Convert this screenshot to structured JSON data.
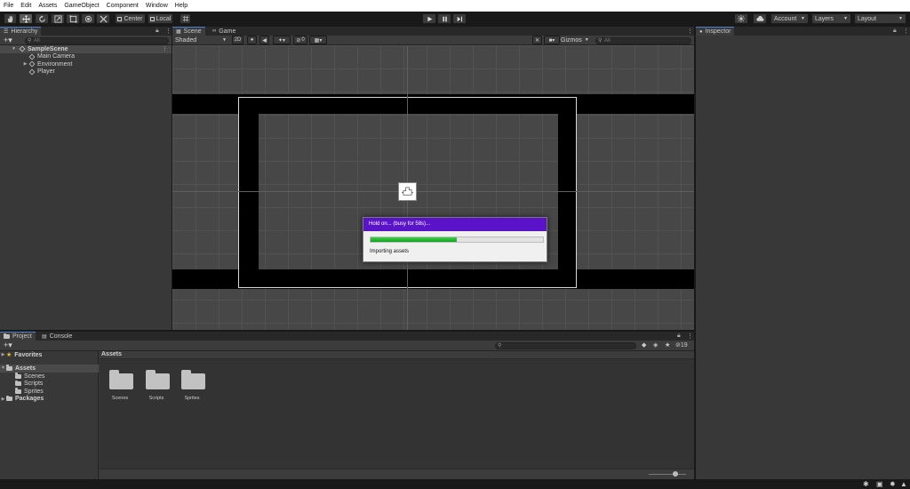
{
  "menu": [
    "File",
    "Edit",
    "Assets",
    "GameObject",
    "Component",
    "Window",
    "Help"
  ],
  "toolbar": {
    "tools": [
      "hand-tool",
      "move-tool",
      "rotate-tool",
      "scale-tool",
      "rect-tool",
      "transform-tool",
      "custom-tool"
    ],
    "pivot_label": "Center",
    "space_label": "Local",
    "account_label": "Account",
    "layers_label": "Layers",
    "layout_label": "Layout"
  },
  "hierarchy": {
    "tab": "Hierarchy",
    "search_placeholder": "All",
    "scene": "SampleScene",
    "items": [
      "Main Camera",
      "Environment",
      "Player"
    ]
  },
  "scene": {
    "tabs": [
      "Scene",
      "Game"
    ],
    "shading": "Shaded",
    "mode_2d": "2D",
    "hidden_count": "0",
    "gizmos": "Gizmos",
    "search_placeholder": "All"
  },
  "inspector": {
    "tab": "Inspector"
  },
  "dialog": {
    "title": "Hold on... (busy for 58s)...",
    "message": "Importing assets",
    "progress": 0.5
  },
  "project": {
    "tabs": [
      "Project",
      "Console"
    ],
    "favorites": "Favorites",
    "assets": "Assets",
    "asset_folders": [
      "Scenes",
      "Scripts",
      "Sprites"
    ],
    "packages": "Packages",
    "breadcrumb": "Assets",
    "hidden_count": "19",
    "folders": [
      "Scenes",
      "Scripts",
      "Sprites"
    ]
  },
  "colors": {
    "dialog_title_bg": "#5a13c9",
    "progress_fill": "#16b025",
    "selection_accent": "#4c7fcf"
  }
}
